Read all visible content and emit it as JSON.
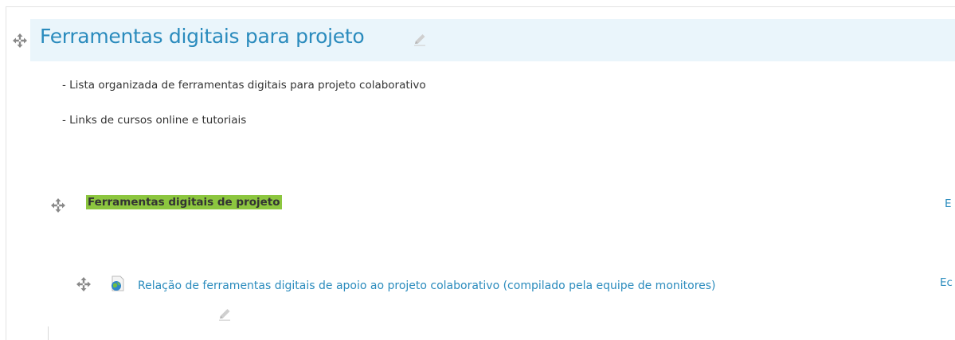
{
  "section": {
    "title": "Ferramentas digitais para projeto",
    "summary": [
      "- Lista organizada de ferramentas digitais para projeto colaborativo",
      "- Links de cursos online e tutoriais"
    ]
  },
  "label_item": {
    "text": "Ferramentas digitais de projeto",
    "edit_label": "E"
  },
  "resource_item": {
    "title": "Relação de ferramentas digitais de apoio ao projeto colaborativo (compilado pela equipe de monitores)",
    "edit_label": "Ec",
    "icon": "url-resource-icon"
  },
  "icons": {
    "move": "move-icon",
    "edit": "pencil-icon"
  },
  "colors": {
    "link": "#2a8bbd",
    "header_bg": "#eaf5fb",
    "highlight": "#8cc63f"
  }
}
